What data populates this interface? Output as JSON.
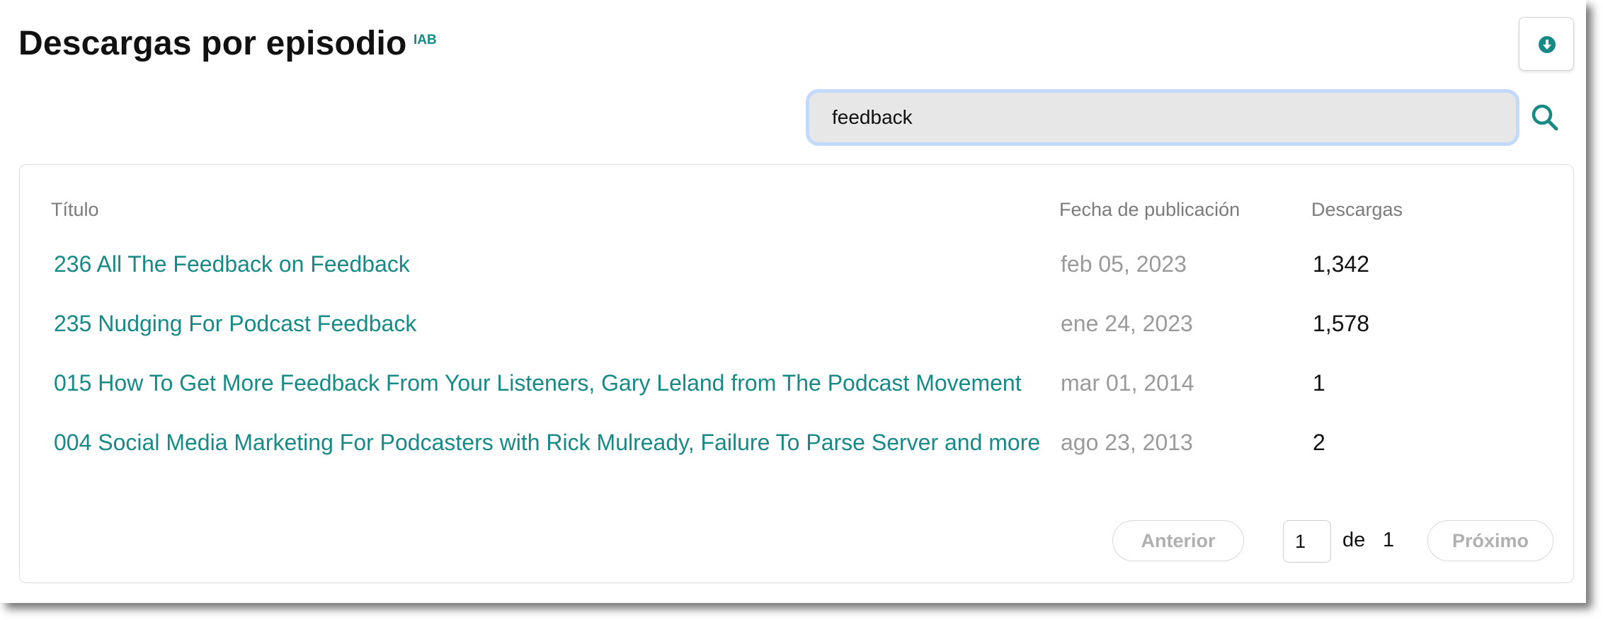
{
  "header": {
    "title": "Descargas por episodio",
    "badge": "IAB"
  },
  "search": {
    "value": "feedback"
  },
  "table": {
    "columns": {
      "title": "Título",
      "date": "Fecha de publicación",
      "downloads": "Descargas"
    },
    "rows": [
      {
        "title": "236 All The Feedback on Feedback",
        "date": "feb 05, 2023",
        "downloads": "1,342"
      },
      {
        "title": "235 Nudging For Podcast Feedback",
        "date": "ene 24, 2023",
        "downloads": "1,578"
      },
      {
        "title": "015 How To Get More Feedback From Your Listeners, Gary Leland from The Podcast Movement",
        "date": "mar 01, 2014",
        "downloads": "1"
      },
      {
        "title": "004 Social Media Marketing For Podcasters with Rick Mulready, Failure To Parse Server and more",
        "date": "ago 23, 2013",
        "downloads": "2"
      }
    ]
  },
  "pagination": {
    "prev_label": "Anterior",
    "page_value": "1",
    "of_label": "de",
    "total_pages": "1",
    "next_label": "Próximo"
  },
  "icons": {
    "download": "download-circle-icon",
    "search": "search-icon"
  },
  "colors": {
    "accent": "#178a86",
    "focus_ring": "#c3d9fb",
    "input_bg": "#e7e7e7",
    "muted_text": "#9a9a9a"
  }
}
